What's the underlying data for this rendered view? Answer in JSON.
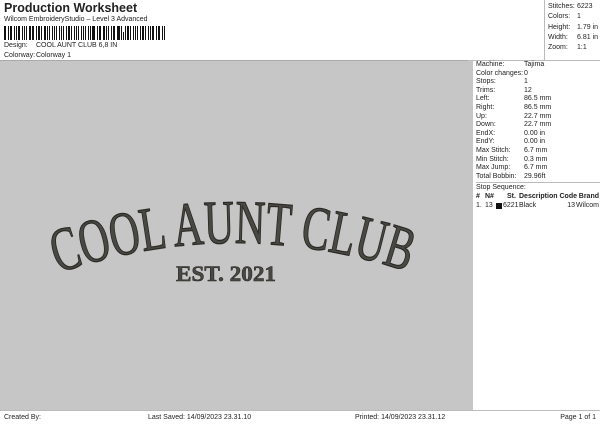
{
  "header": {
    "title": "Production Worksheet",
    "subtitle": "Wilcom EmbroideryStudio – Level 3 Advanced",
    "design_label": "Design:",
    "design_value": "COOL AUNT CLUB 6,8 IN",
    "colorway_label": "Colorway:",
    "colorway_value": "Colorway 1"
  },
  "stats": [
    {
      "label": "Stitches:",
      "value": "6223"
    },
    {
      "label": "Colors:",
      "value": "1"
    },
    {
      "label": "Height:",
      "value": "1.79 in"
    },
    {
      "label": "Width:",
      "value": "6.81 in"
    },
    {
      "label": "Zoom:",
      "value": "1:1"
    }
  ],
  "design": {
    "line1": "COOL AUNT CLUB",
    "line2": "EST. 2021",
    "thread_color": "#4a4842"
  },
  "machine": [
    {
      "label": "Machine:",
      "value": "Tajima"
    },
    {
      "label": "Color changes:",
      "value": "0"
    },
    {
      "label": "Stops:",
      "value": "1"
    },
    {
      "label": "Trims:",
      "value": "12"
    },
    {
      "label": "Left:",
      "value": "86.5 mm"
    },
    {
      "label": "Right:",
      "value": "86.5 mm"
    },
    {
      "label": "Up:",
      "value": "22.7 mm"
    },
    {
      "label": "Down:",
      "value": "22.7 mm"
    },
    {
      "label": "EndX:",
      "value": "0.00 in"
    },
    {
      "label": "EndY:",
      "value": "0.00 in"
    },
    {
      "label": "Max Stitch:",
      "value": "6.7 mm"
    },
    {
      "label": "Min Stitch:",
      "value": "0.3 mm"
    },
    {
      "label": "Max Jump:",
      "value": "6.7 mm"
    },
    {
      "label": "Total Bobbin:",
      "value": "29.96ft"
    }
  ],
  "stop_sequence": {
    "title": "Stop Sequence:",
    "headers": {
      "num": "#",
      "n": "N#",
      "st": "St.",
      "desc": "Description",
      "code": "Code",
      "brand": "Brand"
    },
    "rows": [
      {
        "num": "1.",
        "n": "13",
        "swatch": "#111111",
        "st": "6221",
        "desc": "Black",
        "code": "13",
        "brand": "Wilcom"
      }
    ]
  },
  "footer": {
    "created": "Created By:",
    "saved": "Last Saved: 14/09/2023 23.31.10",
    "printed": "Printed: 14/09/2023 23.31.12",
    "page": "Page 1 of 1"
  }
}
